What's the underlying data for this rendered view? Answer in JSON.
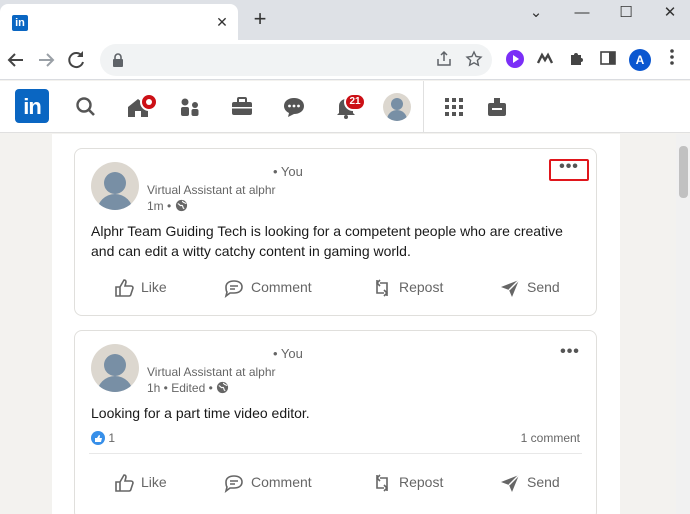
{
  "browser": {
    "tab_close": "✕",
    "new_tab": "+",
    "window_controls": [
      "⌄",
      "—",
      "☐",
      "✕"
    ],
    "avatar_letter": "A",
    "colors": {
      "tabstrip": "#dee1e6",
      "avatar": "#0b57d0"
    }
  },
  "linkedin": {
    "logo": "in",
    "notifications_badge": "21",
    "colors": {
      "brand": "#0a66c2",
      "badge": "#cc1016"
    }
  },
  "posts": [
    {
      "you": "• You",
      "headline": "Virtual Assistant at alphr",
      "meta": "1m •",
      "text": "Alphr Team Guiding Tech is looking for a competent people who are creative and can edit a witty catchy content in gaming world.",
      "more": "•••",
      "actions": [
        "Like",
        "Comment",
        "Repost",
        "Send"
      ]
    },
    {
      "you": "• You",
      "headline": "Virtual Assistant at alphr",
      "meta": "1h • Edited •",
      "text": "Looking for a part time video editor.",
      "more": "•••",
      "reactions_count": "1",
      "comments": "1 comment",
      "actions": [
        "Like",
        "Comment",
        "Repost",
        "Send"
      ]
    }
  ]
}
